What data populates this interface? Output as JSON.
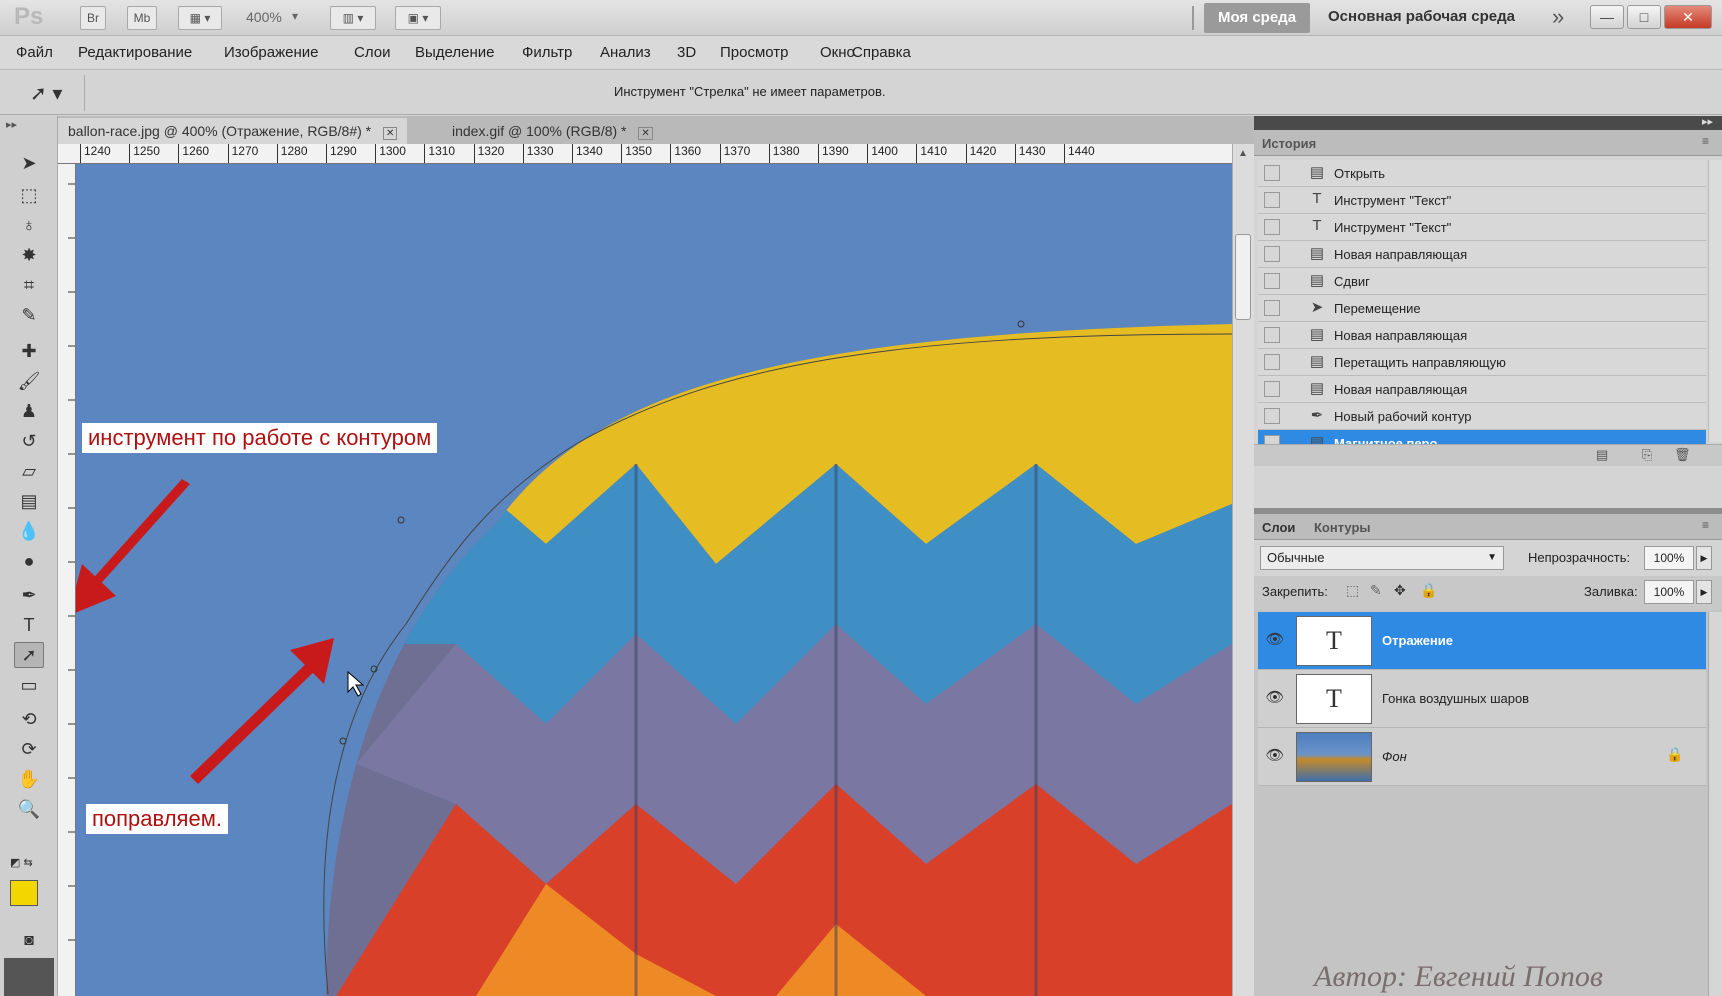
{
  "titlebar": {
    "logo": "Ps",
    "bridge_btn": "Br",
    "minibridge_btn": "Mb",
    "zoom": "400%",
    "workspace_active": "Моя среда",
    "workspace_label": "Основная рабочая среда",
    "more": "»"
  },
  "menu": [
    "Файл",
    "Редактирование",
    "Изображение",
    "Слои",
    "Выделение",
    "Фильтр",
    "Анализ",
    "3D",
    "Просмотр",
    "Окно",
    "Справка"
  ],
  "options": {
    "hint": "Инструмент \"Стрелка\" не имеет параметров."
  },
  "tabs": [
    {
      "label": "ballon-race.jpg @ 400% (Отражение, RGB/8#) *"
    },
    {
      "label": "index.gif @ 100% (RGB/8) *"
    }
  ],
  "ruler_top": [
    "1240",
    "1250",
    "1260",
    "1270",
    "1280",
    "1290",
    "1300",
    "1310",
    "1320",
    "1330",
    "1340",
    "1350",
    "1360",
    "1370",
    "1380",
    "1390",
    "1400",
    "1410",
    "1420",
    "1430",
    "1440"
  ],
  "history": {
    "title": "История",
    "items": [
      {
        "icon": "doc-icon",
        "label": "Открыть"
      },
      {
        "icon": "text-icon",
        "label": "Инструмент \"Текст\""
      },
      {
        "icon": "text-icon",
        "label": "Инструмент \"Текст\""
      },
      {
        "icon": "doc-icon",
        "label": "Новая направляющая"
      },
      {
        "icon": "doc-icon",
        "label": "Сдвиг"
      },
      {
        "icon": "move-icon",
        "label": "Перемещение"
      },
      {
        "icon": "doc-icon",
        "label": "Новая направляющая"
      },
      {
        "icon": "doc-icon",
        "label": "Перетащить направляющую"
      },
      {
        "icon": "doc-icon",
        "label": "Новая направляющая"
      },
      {
        "icon": "pen-icon",
        "label": "Новый рабочий контур"
      },
      {
        "icon": "doc-icon",
        "label": "Магнитное перо"
      }
    ]
  },
  "layers_panel": {
    "tab_layers": "Слои",
    "tab_paths": "Контуры",
    "blend_mode": "Обычные",
    "opacity_label": "Непрозрачность:",
    "opacity_value": "100%",
    "lock_label": "Закрепить:",
    "fill_label": "Заливка:",
    "fill_value": "100%",
    "layers": [
      {
        "name": "Отражение",
        "thumb": "T"
      },
      {
        "name": "Гонка воздушных шаров",
        "thumb": "T"
      },
      {
        "name": "Фон",
        "thumb": ""
      }
    ]
  },
  "annotations": {
    "callout_top": "инструмент по работе с контуром",
    "callout_bottom": "поправляем.",
    "watermark": "Автор: Евгений Попов"
  },
  "colors": {
    "accent": "#2f8ae3",
    "sky": "#5c86bf",
    "callout_text": "#b01010"
  }
}
